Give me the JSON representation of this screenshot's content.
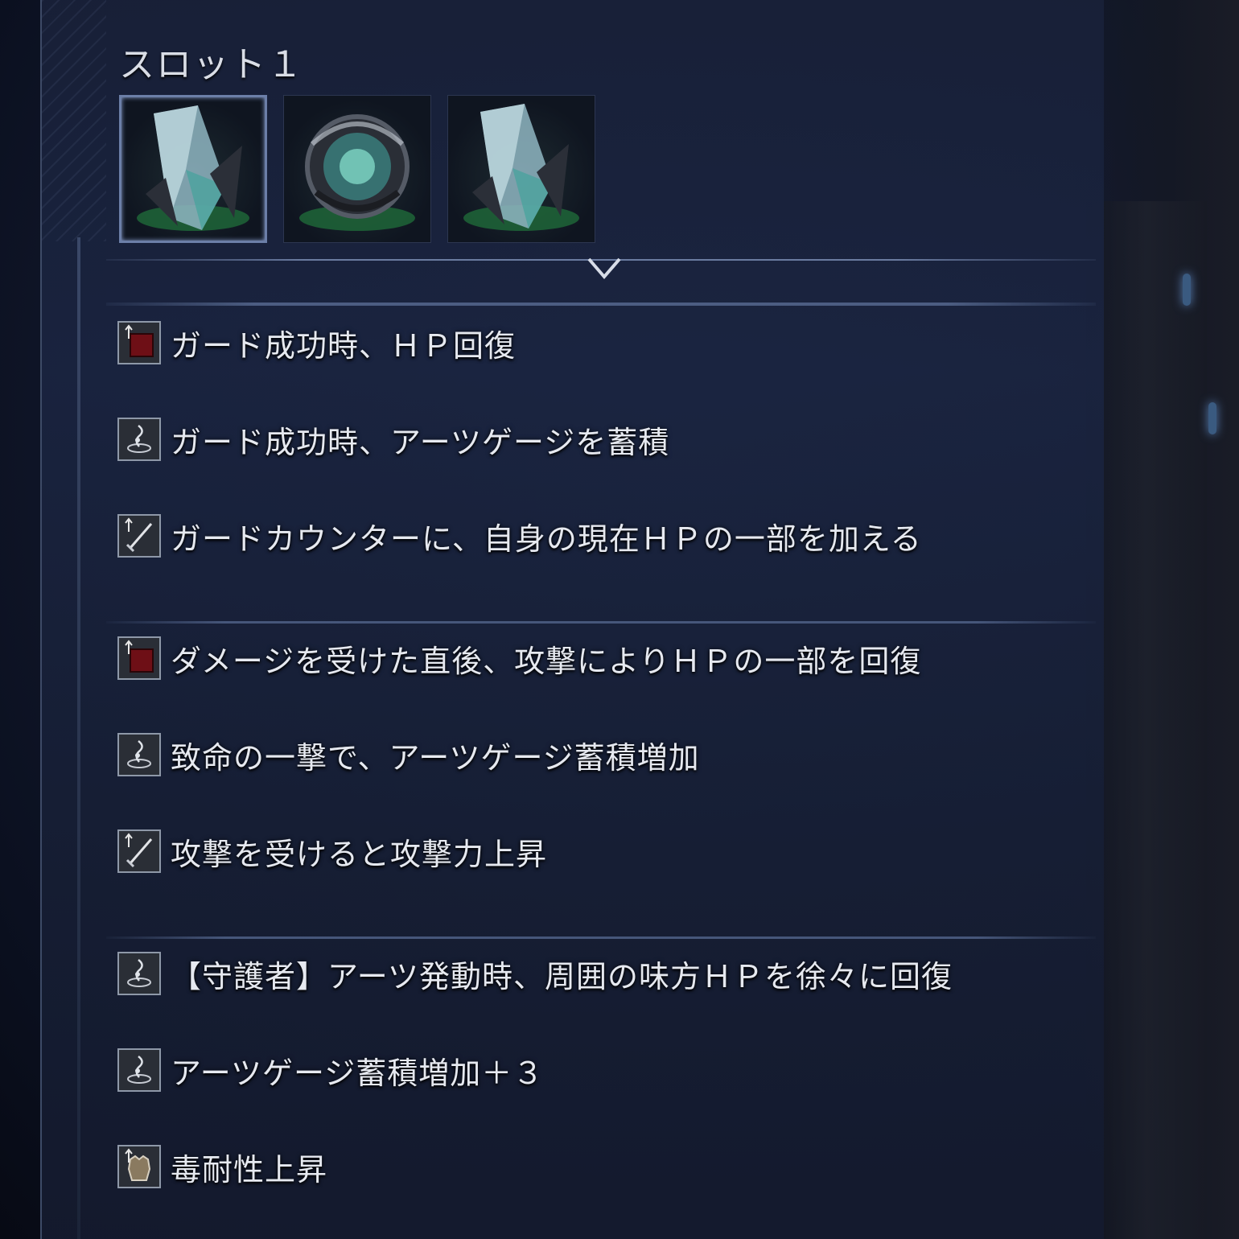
{
  "slot": {
    "title": "スロット１"
  },
  "gems": [
    {
      "name": "crystal-shard-icon",
      "selected": true
    },
    {
      "name": "thorn-orb-icon",
      "selected": false
    },
    {
      "name": "crystal-shard-icon",
      "selected": false
    }
  ],
  "effects": [
    {
      "icon": "hp-up-icon",
      "text": "ガード成功時、ＨＰ回復"
    },
    {
      "icon": "arts-gauge-icon",
      "text": "ガード成功時、アーツゲージを蓄積"
    },
    {
      "icon": "attack-up-icon",
      "text": "ガードカウンターに、自身の現在ＨＰの一部を加える"
    },
    {
      "icon": "hp-up-icon",
      "text": "ダメージを受けた直後、攻撃によりＨＰの一部を回復"
    },
    {
      "icon": "arts-gauge-icon",
      "text": "致命の一撃で、アーツゲージ蓄積増加"
    },
    {
      "icon": "attack-up-icon",
      "text": "攻撃を受けると攻撃力上昇"
    },
    {
      "icon": "arts-gauge-icon",
      "text": "【守護者】アーツ発動時、周囲の味方ＨＰを徐々に回復"
    },
    {
      "icon": "arts-gauge-icon",
      "text": "アーツゲージ蓄積増加＋３"
    },
    {
      "icon": "armor-up-icon",
      "text": "毒耐性上昇"
    }
  ]
}
